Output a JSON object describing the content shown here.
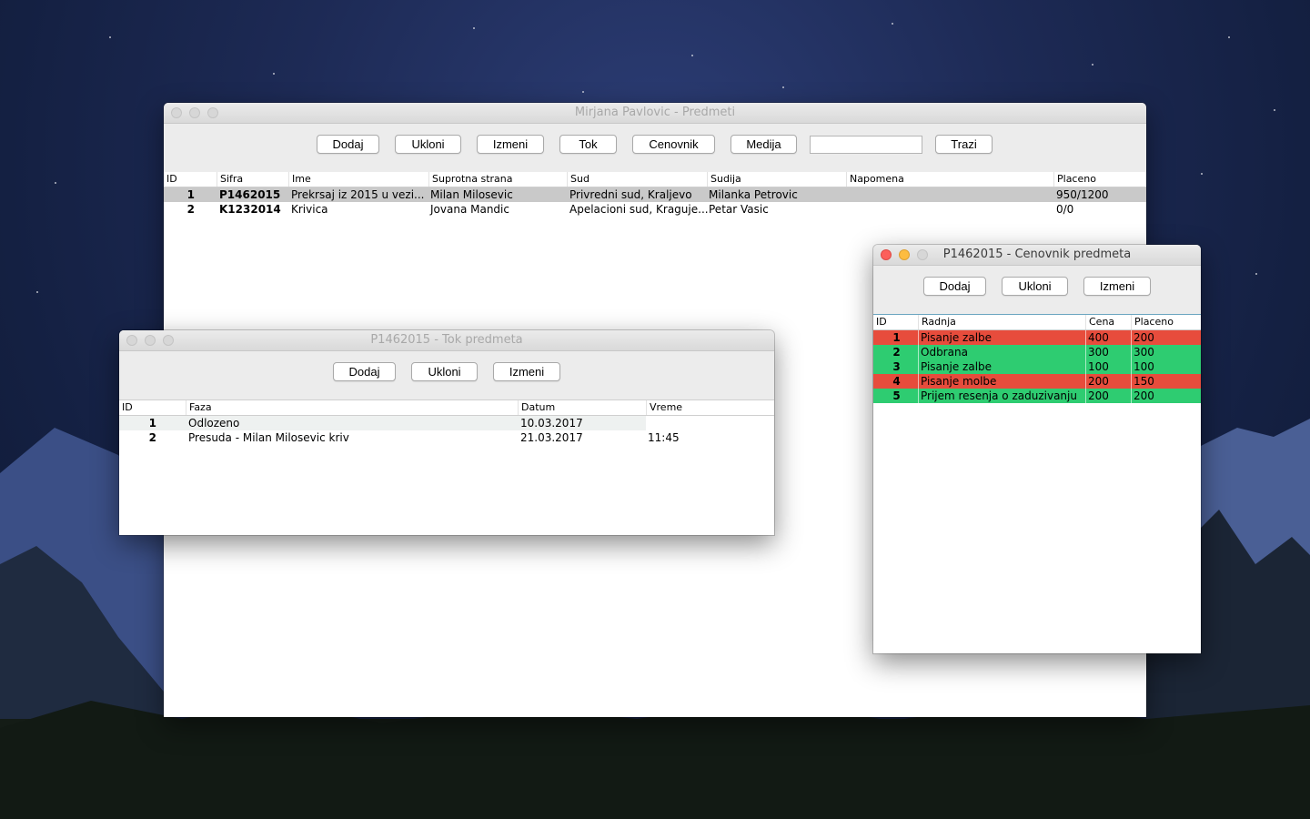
{
  "main_window": {
    "title": "Mirjana Pavlovic - Predmeti",
    "buttons": {
      "add": "Dodaj",
      "remove": "Ukloni",
      "edit": "Izmeni",
      "flow": "Tok",
      "pricelist": "Cenovnik",
      "media": "Medija",
      "search": "Trazi"
    },
    "search_value": "",
    "columns": [
      "ID",
      "Sifra",
      "Ime",
      "Suprotna strana",
      "Sud",
      "Sudija",
      "Napomena",
      "Placeno"
    ],
    "rows": [
      {
        "id": "1",
        "sifra": "P1462015",
        "ime": "Prekrsaj iz 2015 u vezi...",
        "strana": "Milan Milosevic",
        "sud": "Privredni sud, Kraljevo",
        "sudija": "Milanka Petrovic",
        "napomena": "",
        "placeno": "950/1200"
      },
      {
        "id": "2",
        "sifra": "K1232014",
        "ime": "Krivica",
        "strana": "Jovana Mandic",
        "sud": "Apelacioni sud, Kraguje...",
        "sudija": "Petar Vasic",
        "napomena": "",
        "placeno": "0/0"
      }
    ]
  },
  "tok_window": {
    "title": "P1462015 - Tok predmeta",
    "buttons": {
      "add": "Dodaj",
      "remove": "Ukloni",
      "edit": "Izmeni"
    },
    "columns": [
      "ID",
      "Faza",
      "Datum",
      "Vreme"
    ],
    "rows": [
      {
        "id": "1",
        "faza": "Odlozeno",
        "datum": "10.03.2017",
        "vreme": ""
      },
      {
        "id": "2",
        "faza": "Presuda - Milan Milosevic kriv",
        "datum": "21.03.2017",
        "vreme": "11:45"
      }
    ]
  },
  "cenovnik_window": {
    "title": "P1462015 - Cenovnik predmeta",
    "buttons": {
      "add": "Dodaj",
      "remove": "Ukloni",
      "edit": "Izmeni"
    },
    "columns": [
      "ID",
      "Radnja",
      "Cena",
      "Placeno"
    ],
    "rows": [
      {
        "id": "1",
        "radnja": "Pisanje zalbe",
        "cena": "400",
        "placeno": "200",
        "status": "unpaid"
      },
      {
        "id": "2",
        "radnja": "Odbrana",
        "cena": "300",
        "placeno": "300",
        "status": "paid"
      },
      {
        "id": "3",
        "radnja": "Pisanje zalbe",
        "cena": "100",
        "placeno": "100",
        "status": "paid"
      },
      {
        "id": "4",
        "radnja": "Pisanje molbe",
        "cena": "200",
        "placeno": "150",
        "status": "unpaid"
      },
      {
        "id": "5",
        "radnja": "Prijem resenja o zaduzivanju",
        "cena": "200",
        "placeno": "200",
        "status": "paid"
      }
    ],
    "colors": {
      "paid": "#2ecc71",
      "unpaid": "#e74c3c"
    }
  }
}
